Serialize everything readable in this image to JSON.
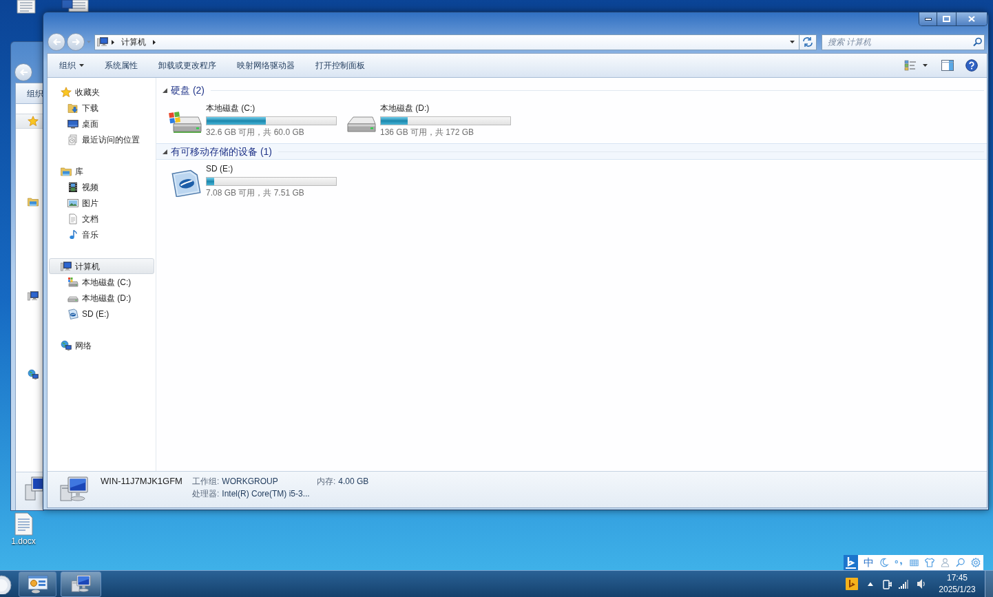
{
  "desktop": {
    "icons": [
      {
        "label": "1.docx"
      }
    ]
  },
  "background_window": {
    "toolbar": [
      {
        "label": "组织"
      }
    ]
  },
  "explorer": {
    "address_bar": {
      "path": [
        {
          "label": "计算机"
        }
      ]
    },
    "search": {
      "placeholder": "搜索 计算机"
    },
    "toolbar": [
      {
        "label": "组织",
        "kind": "menu"
      },
      {
        "label": "系统属性",
        "kind": "command"
      },
      {
        "label": "卸载或更改程序",
        "kind": "command"
      },
      {
        "label": "映射网络驱动器",
        "kind": "command"
      },
      {
        "label": "打开控制面板",
        "kind": "command"
      }
    ],
    "navigation": [
      {
        "label": "收藏夹",
        "kind": "favorites",
        "selected": false,
        "children": [
          {
            "label": "下载",
            "kind": "downloads",
            "selected": false
          },
          {
            "label": "桌面",
            "kind": "desktop",
            "selected": false
          },
          {
            "label": "最近访问的位置",
            "kind": "recent",
            "selected": false
          }
        ]
      },
      {
        "label": "库",
        "kind": "library",
        "selected": false,
        "children": [
          {
            "label": "视频",
            "kind": "videos",
            "selected": false
          },
          {
            "label": "图片",
            "kind": "pictures",
            "selected": false
          },
          {
            "label": "文档",
            "kind": "documents",
            "selected": false
          },
          {
            "label": "音乐",
            "kind": "music",
            "selected": false
          }
        ]
      },
      {
        "label": "计算机",
        "kind": "computer",
        "selected": true,
        "children": [
          {
            "label": "本地磁盘 (C:)",
            "kind": "system_drive",
            "selected": false
          },
          {
            "label": "本地磁盘 (D:)",
            "kind": "drive",
            "selected": false
          },
          {
            "label": "SD (E:)",
            "kind": "sd_card",
            "selected": false
          }
        ]
      },
      {
        "label": "网络",
        "kind": "network",
        "selected": false
      }
    ],
    "groups": [
      {
        "title": "硬盘 (2)",
        "expanded": true,
        "selected": false,
        "drives": [
          {
            "name": "本地磁盘 (C:)",
            "kind": "system_drive",
            "level": 0.46,
            "space": "32.6 GB 可用，共 60.0 GB"
          },
          {
            "name": "本地磁盘 (D:)",
            "kind": "drive",
            "level": 0.21,
            "space": "136 GB 可用，共 172 GB"
          }
        ]
      },
      {
        "title": "有可移动存储的设备 (1)",
        "expanded": true,
        "selected": true,
        "drives": [
          {
            "name": "SD (E:)",
            "kind": "sd_card",
            "level": 0.06,
            "space": "7.08 GB 可用，共 7.51 GB"
          }
        ]
      }
    ],
    "details": {
      "computer_name": "WIN-11J7MJK1GFM",
      "fields": [
        {
          "label": "工作组:",
          "value": "WORKGROUP"
        },
        {
          "label": "内存:",
          "value": "4.00 GB"
        },
        {
          "label": "处理器:",
          "value": "Intel(R) Core(TM) i5-3..."
        }
      ]
    }
  },
  "taskbar": {
    "input_method": {
      "mode": "中"
    },
    "clock": {
      "time": "17:45",
      "date": "2025/1/23"
    }
  }
}
